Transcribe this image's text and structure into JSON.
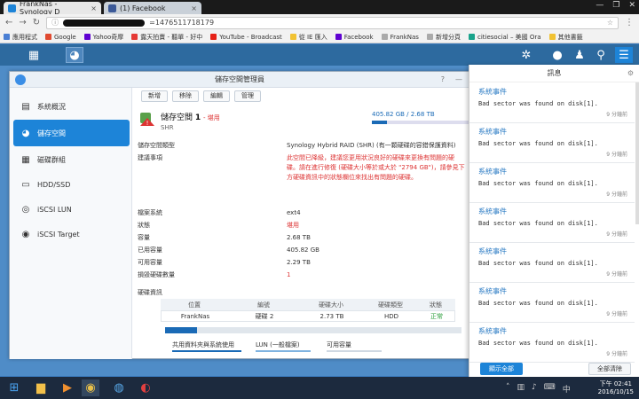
{
  "browser": {
    "tabs": [
      {
        "label": "FrankNas - Synology D",
        "close": "×"
      },
      {
        "label": "(1) Facebook",
        "close": "×"
      }
    ],
    "window_controls": [
      "—",
      "❐",
      "✕"
    ],
    "url_suffix": "=1476511718179",
    "bookmarks": [
      {
        "label": "應用程式",
        "color": "#4a7fd4"
      },
      {
        "label": "Google",
        "color": "#e0492f"
      },
      {
        "label": "Yahoo奇摩",
        "color": "#5f01d1"
      },
      {
        "label": "露天拍賣 - 聽單 - 好中",
        "color": "#e53935"
      },
      {
        "label": "YouTube - Broadcast",
        "color": "#e62117"
      },
      {
        "label": "從 IE 匯入",
        "color": "#f1c232"
      },
      {
        "label": "Facebook",
        "color": "#5f01d1"
      },
      {
        "label": "FrankNas",
        "color": "#aaaaaa"
      },
      {
        "label": "新增分頁",
        "color": "#aaaaaa"
      },
      {
        "label": "citiesocial – 美國 Ora",
        "color": "#19a38b"
      },
      {
        "label": "其他書籤",
        "color": "#f1c232"
      }
    ]
  },
  "app": {
    "title": "儲存空間管理員",
    "title_buttons": [
      "?",
      "—"
    ],
    "sidebar": [
      {
        "label": "系統概況",
        "icon": "overview-icon",
        "active": false
      },
      {
        "label": "儲存空間",
        "icon": "storage-icon",
        "active": true
      },
      {
        "label": "磁碟群組",
        "icon": "diskgroup-icon",
        "active": false
      },
      {
        "label": "HDD/SSD",
        "icon": "hdd-icon",
        "active": false
      },
      {
        "label": "iSCSI LUN",
        "icon": "iscsi-lun-icon",
        "active": false
      },
      {
        "label": "iSCSI Target",
        "icon": "iscsi-target-icon",
        "active": false
      }
    ],
    "toolbar": [
      "新增",
      "移除",
      "編輯",
      "管理"
    ],
    "volume": {
      "name": "儲存空間",
      "number": "1",
      "status": "- 堪用",
      "sub": "SHR",
      "usage_text": "405.82 GB / 2.68 TB",
      "usage_fraction": 0.15
    },
    "details": [
      {
        "key": "儲存空間類型",
        "value": "Synology Hybrid RAID (SHR) (有一顆硬碟的容錯保護資料)",
        "red": false
      },
      {
        "key": "建議事項",
        "value": "此空間已降級，建議您更用狀況良好的硬碟來更換有問題的硬碟。請在進行修復 (硬碟大小等於或大於 \"2794 GB\")，請參見下方硬碟資訊中的狀態欄位來找出有問題的硬碟。",
        "red": true
      },
      {
        "key": "檔案系統",
        "value": "ext4",
        "red": false
      },
      {
        "key": "狀態",
        "value": "堪用",
        "red": true
      },
      {
        "key": "容量",
        "value": "2.68 TB",
        "red": false
      },
      {
        "key": "已用容量",
        "value": "405.82 GB",
        "red": false
      },
      {
        "key": "可用容量",
        "value": "2.29 TB",
        "red": false
      },
      {
        "key": "損毀硬碟數量",
        "value": "1",
        "red": true
      }
    ],
    "disk_section": "硬碟資訊",
    "disk_table": {
      "headers": [
        "位置",
        "編號",
        "硬碟大小",
        "硬碟類型",
        "狀態"
      ],
      "rows": [
        [
          "FrankNas",
          "硬碟 2",
          "2.73 TB",
          "HDD",
          "正常"
        ]
      ]
    },
    "bottom_legend": [
      "共用資料夾與系統使用",
      "LUN (一般檔案)",
      "可用容量"
    ]
  },
  "notifications": {
    "header": "訊息",
    "items": [
      {
        "title": "系統事件",
        "message": "Bad sector was found on disk[1].",
        "time": "9 分鐘前"
      },
      {
        "title": "系統事件",
        "message": "Bad sector was found on disk[1].",
        "time": "9 分鐘前"
      },
      {
        "title": "系統事件",
        "message": "Bad sector was found on disk[1].",
        "time": "9 分鐘前"
      },
      {
        "title": "系統事件",
        "message": "Bad sector was found on disk[1].",
        "time": "9 分鐘前"
      },
      {
        "title": "系統事件",
        "message": "Bad sector was found on disk[1].",
        "time": "9 分鐘前"
      },
      {
        "title": "系統事件",
        "message": "Bad sector was found on disk[1].",
        "time": "9 分鐘前"
      },
      {
        "title": "系統事件",
        "message": "Bad sector was found on disk[1].",
        "time": "9 分鐘前"
      }
    ],
    "show_all": "顯示全部",
    "clear_all": "全部清除"
  },
  "taskbar": {
    "time": "下午 02:41",
    "date": "2016/10/15"
  },
  "colors": {
    "accent": "#1d84d8",
    "warning_red": "#dd3333",
    "dsm_bar": "#2d6a9f"
  }
}
